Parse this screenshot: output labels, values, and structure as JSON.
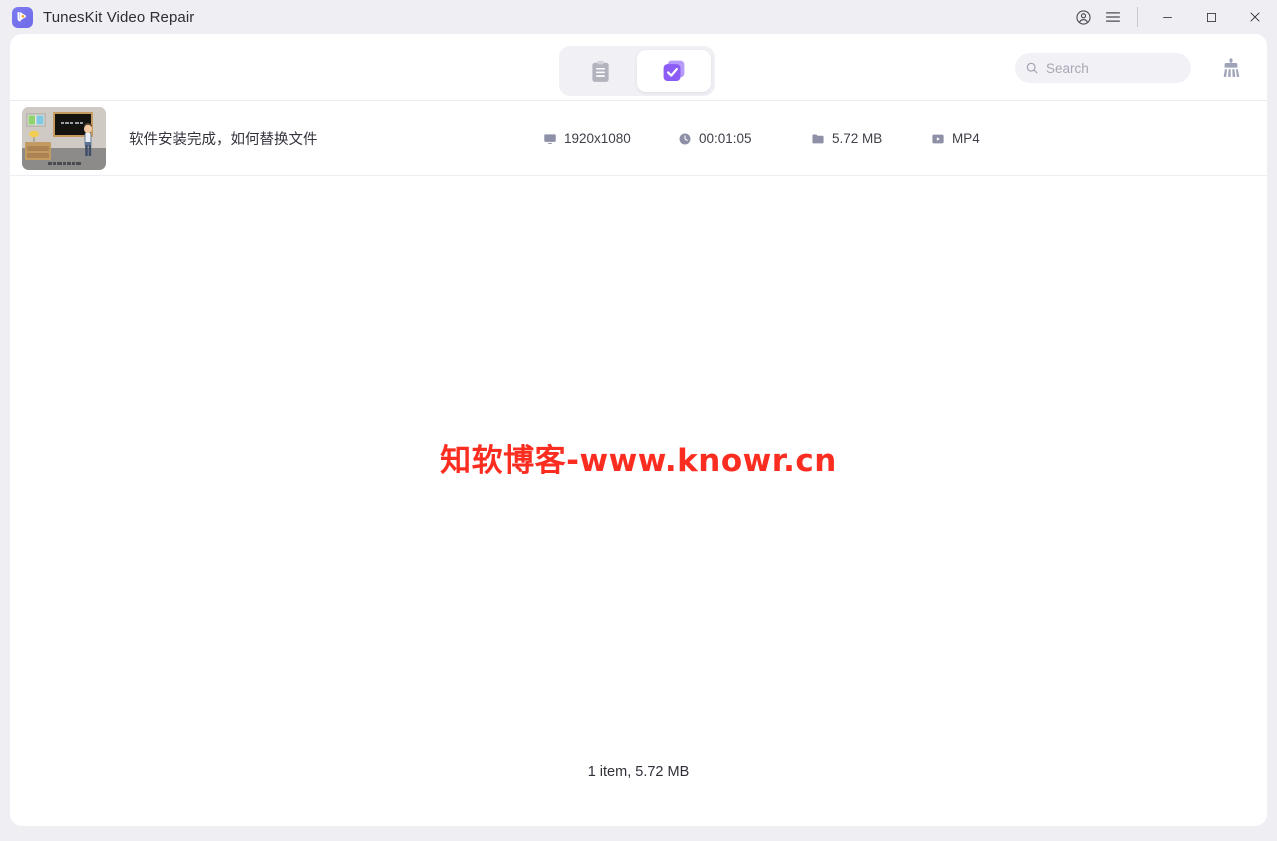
{
  "window": {
    "title": "TunesKit Video Repair",
    "logo_icon": "tuneskit-logo-icon",
    "controls": {
      "account_icon": "account-circle-icon",
      "menu_icon": "hamburger-menu-icon",
      "minimize_icon": "minimize-icon",
      "maximize_icon": "maximize-icon",
      "close_icon": "close-icon"
    }
  },
  "toolbar": {
    "tabs": [
      {
        "id": "clipboard",
        "icon": "clipboard-list-icon",
        "active": false
      },
      {
        "id": "repaired",
        "icon": "check-square-stack-icon",
        "active": true
      }
    ],
    "search": {
      "placeholder": "Search",
      "value": "",
      "icon": "search-icon"
    },
    "clear_icon": "broom-clear-icon"
  },
  "file_list": {
    "rows": [
      {
        "name": "软件安装完成，如何替换文件",
        "thumbnail_icon": "video-thumbnail-classroom",
        "resolution": "1920x1080",
        "resolution_icon": "monitor-icon",
        "duration": "00:01:05",
        "duration_icon": "clock-icon",
        "size": "5.72 MB",
        "size_icon": "folder-icon",
        "format": "MP4",
        "format_icon": "video-file-icon"
      }
    ]
  },
  "watermark": {
    "text": "知软博客-www.knowr.cn",
    "color": "#fb2d21"
  },
  "footer": {
    "status": "1 item, 5.72 MB"
  },
  "colors": {
    "accent": "#8b5cf6",
    "logo": "#6f6ae8",
    "window_bg": "#efeef3",
    "panel_bg": "#ffffff",
    "tab_group_bg": "#f1f0f5",
    "meta_icon": "#8d90a6"
  }
}
